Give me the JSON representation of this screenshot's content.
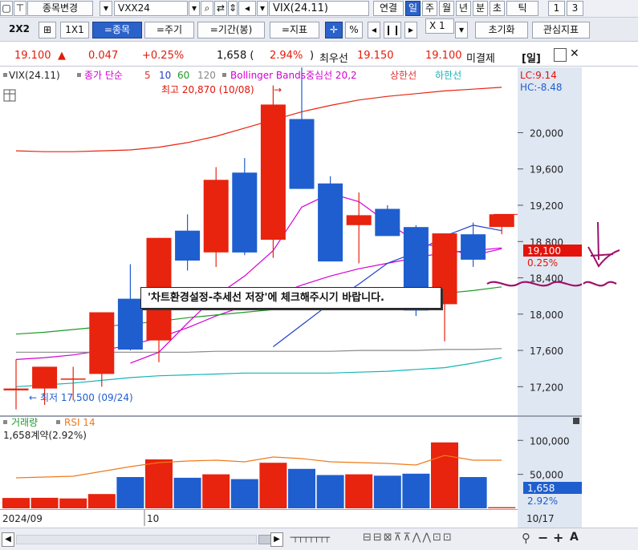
{
  "toolbar1": {
    "item_change": "종목변경",
    "symbol_code": "VXX24",
    "symbol_name": "VIX(24.11)",
    "linked": "연결",
    "periods": [
      "일",
      "주",
      "월",
      "년",
      "분",
      "초",
      "틱"
    ],
    "active_period": "일",
    "nums": [
      "1",
      "3"
    ]
  },
  "toolbar2": {
    "layout": "2X2",
    "ratio": "1X1",
    "item_btn": "=종목",
    "cycle_btn": "=주기",
    "range_btn": "=기간(봉)",
    "indicator_btn": "=지표",
    "pct": "%",
    "zoom": "X 1",
    "reset": "초기화",
    "watch": "관심지표"
  },
  "quote": {
    "price": "19.100",
    "arrow": "▲",
    "change": "0.047",
    "change_pct": "+0.25%",
    "volume": "1,658 (",
    "volume_pct": "2.94%",
    "volume_close": ")",
    "best_ask_label": "최우선",
    "best_ask": "19.150",
    "best_bid": "19.100",
    "unsettled": "미결제",
    "day": "[일]"
  },
  "note": "'차트환경설정-추세선 저장'에 체크해주시기 바랍니다.",
  "bottom": {
    "scroll_icons": [
      "◀",
      "▶"
    ]
  },
  "chart_data": {
    "type": "candlestick",
    "legend": {
      "symbol": "VIX(24.11)",
      "ma_label": "종가 단순",
      "ma_periods": [
        "5",
        "10",
        "60",
        "120"
      ],
      "bb_label": "Bollinger Bands중심선 20,2",
      "bb_upper": "상한선",
      "bb_lower": "하한선"
    },
    "top_right": [
      "LC:9.14",
      "HC:-8.48"
    ],
    "high_annotation": "최고 20,870 (10/08)",
    "low_annotation": "최저 17,500 (09/24)",
    "yticks": [
      "20,000",
      "19,600",
      "19,200",
      "18,800",
      "18,400",
      "18,000",
      "17,600",
      "17,200"
    ],
    "ytick_values": [
      20000,
      19600,
      19200,
      18800,
      18400,
      18000,
      17600,
      17200
    ],
    "price_label": "19,100",
    "price_label_pct": "0.25%",
    "price_value": 19100,
    "ylim": [
      16920,
      20720
    ],
    "candles": [
      {
        "o": 17160,
        "h": 17500,
        "l": 16950,
        "c": 17180
      },
      {
        "o": 17180,
        "h": 17420,
        "l": 17000,
        "c": 17420
      },
      {
        "o": 17280,
        "h": 17420,
        "l": 17050,
        "c": 17290
      },
      {
        "o": 17340,
        "h": 18020,
        "l": 17200,
        "c": 18020
      },
      {
        "o": 18170,
        "h": 18550,
        "l": 17600,
        "c": 17610
      },
      {
        "o": 17710,
        "h": 18840,
        "l": 17470,
        "c": 18840
      },
      {
        "o": 18920,
        "h": 19100,
        "l": 18480,
        "c": 18590
      },
      {
        "o": 18680,
        "h": 19620,
        "l": 18520,
        "c": 19480
      },
      {
        "o": 19560,
        "h": 19720,
        "l": 18650,
        "c": 18680
      },
      {
        "o": 18820,
        "h": 20520,
        "l": 18620,
        "c": 20310
      },
      {
        "o": 20150,
        "h": 20870,
        "l": 19380,
        "c": 19380
      },
      {
        "o": 19440,
        "h": 19520,
        "l": 18580,
        "c": 18580
      },
      {
        "o": 18980,
        "h": 19340,
        "l": 18560,
        "c": 19090
      },
      {
        "o": 19160,
        "h": 19200,
        "l": 18920,
        "c": 18860
      },
      {
        "o": 18960,
        "h": 18980,
        "l": 17980,
        "c": 18040
      },
      {
        "o": 18110,
        "h": 18890,
        "l": 17700,
        "c": 18890
      },
      {
        "o": 18880,
        "h": 19010,
        "l": 18520,
        "c": 18600
      },
      {
        "o": 18960,
        "h": 18960,
        "l": 18880,
        "c": 19100
      }
    ],
    "colors_up": "#e8230e",
    "colors_down": "#1f5ecf",
    "ma5": [
      null,
      null,
      null,
      null,
      17460,
      17580,
      17900,
      18200,
      18420,
      18700,
      19180,
      19330,
      19240,
      19010,
      18800,
      18720,
      18650,
      18720
    ],
    "ma10": [
      null,
      null,
      null,
      null,
      null,
      null,
      null,
      null,
      null,
      17640,
      17880,
      18120,
      18330,
      18560,
      18680,
      18860,
      18980,
      18920
    ],
    "ma60": [
      17780,
      17800,
      17830,
      17860,
      17890,
      17920,
      17960,
      17990,
      18020,
      18050,
      18080,
      18110,
      18140,
      18170,
      18200,
      18230,
      18260,
      18300
    ],
    "ma120": [
      17580,
      17580,
      17580,
      17580,
      17580,
      17580,
      17580,
      17590,
      17590,
      17590,
      17590,
      17590,
      17600,
      17600,
      17600,
      17610,
      17610,
      17620
    ],
    "bb_mid": [
      17500,
      17520,
      17550,
      17600,
      17660,
      17740,
      17850,
      17980,
      18090,
      18200,
      18320,
      18420,
      18500,
      18560,
      18620,
      18680,
      18700,
      18730
    ],
    "bb_upper": [
      19800,
      19790,
      19790,
      19800,
      19810,
      19840,
      19890,
      19960,
      20050,
      20140,
      20230,
      20300,
      20360,
      20400,
      20430,
      20460,
      20480,
      20500
    ],
    "bb_lower": [
      17200,
      17220,
      17240,
      17270,
      17300,
      17320,
      17330,
      17340,
      17350,
      17350,
      17350,
      17350,
      17360,
      17370,
      17390,
      17410,
      17460,
      17520
    ],
    "volume_label": "거래량",
    "rsi_label": "RSI 14",
    "volume_info": "1,658계약(2.92%)",
    "volume": [
      15200,
      15500,
      14500,
      21000,
      46000,
      72000,
      45000,
      50000,
      43000,
      67000,
      58000,
      49000,
      50000,
      48000,
      51000,
      97000,
      46000,
      1658
    ],
    "volume_yticks": [
      "100,000",
      "50,000"
    ],
    "volume_ytick_values": [
      100000,
      50000
    ],
    "volume_ylim": [
      0,
      118000
    ],
    "volume_current": "1,658",
    "volume_current_pct": "2.92%",
    "rsi": [
      38,
      39,
      40,
      46,
      52,
      57,
      59,
      60,
      58,
      64,
      62,
      58,
      57,
      56,
      54,
      66,
      60,
      60
    ],
    "x_labels": [
      "2024/09",
      "10",
      "10/17"
    ]
  }
}
